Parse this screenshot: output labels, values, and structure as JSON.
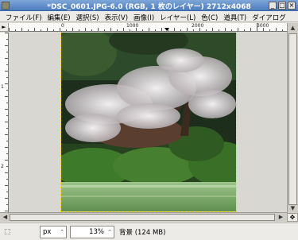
{
  "window": {
    "title": "*DSC_0601.JPG-6.0 (RGB, 1 枚のレイヤー) 2712x4068",
    "buttons": {
      "minimize": "_",
      "maximize": "□",
      "close": "×"
    }
  },
  "menu": {
    "items": [
      "ファイル(F)",
      "編集(E)",
      "選択(S)",
      "表示(V)",
      "画像(I)",
      "レイヤー(L)",
      "色(C)",
      "道具(T)",
      "ダイアログ"
    ]
  },
  "rulers": {
    "horizontal": [
      "0",
      "1000",
      "2000",
      "3000"
    ],
    "vertical": [
      "1",
      "2"
    ]
  },
  "statusbar": {
    "unit": "px",
    "zoom": "13%",
    "message": "背景 (124 MB)"
  },
  "icons": {
    "menu_arrow": "►",
    "pointer": "⬚",
    "spin": "⌃"
  }
}
